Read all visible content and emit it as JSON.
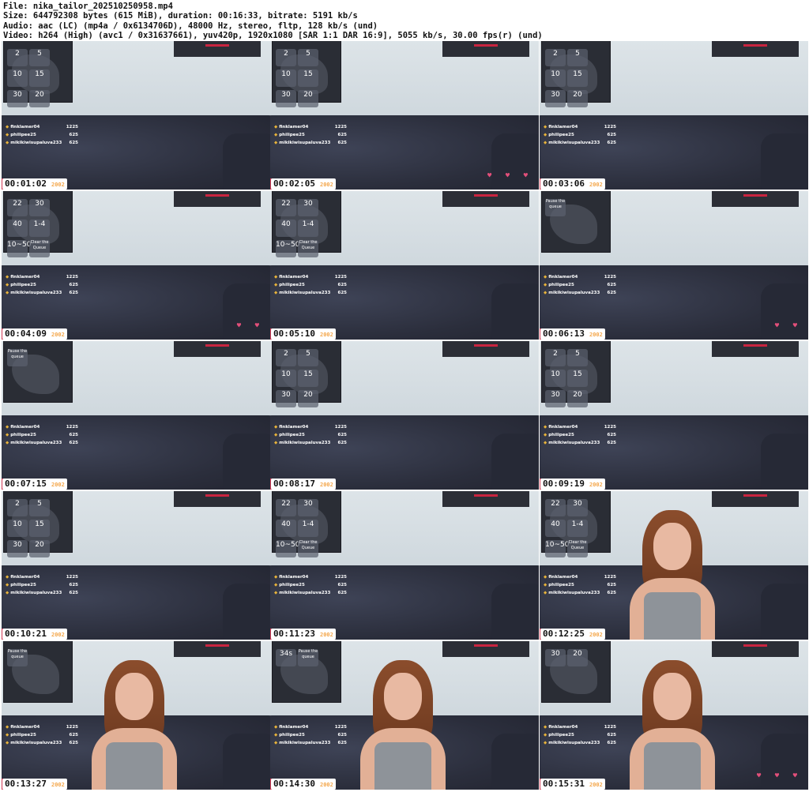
{
  "header": {
    "file": "File: nika_tailor_202510250958.mp4",
    "size": "Size: 644792308 bytes (615 MiB), duration: 00:16:33, bitrate: 5191 kb/s",
    "audio": "Audio: aac (LC) (mp4a / 0x6134706D), 48000 Hz, stereo, fltp, 128 kb/s (und)",
    "video": "Video: h264 (High) (avc1 / 0x31637661), yuv420p, 1920x1080 [SAR 1:1 DAR 16:9], 5055 kb/s, 30.00 fps(r) (und)"
  },
  "leaderboard": [
    {
      "name": "finklamer04",
      "value": "1225"
    },
    {
      "name": "philipee25",
      "value": "625"
    },
    {
      "name": "mikikiwisupaluva233",
      "value": "625"
    }
  ],
  "overlay_fade": "2002",
  "thumbnails": [
    {
      "time": "00:01:02",
      "tiles": [
        "2",
        "5",
        "10",
        "15",
        "30",
        "20"
      ],
      "person": false,
      "icons": ""
    },
    {
      "time": "00:02:05",
      "tiles": [
        "2",
        "5",
        "10",
        "15",
        "30",
        "20"
      ],
      "person": false,
      "icons": "♥ ♥ ♥"
    },
    {
      "time": "00:03:06",
      "tiles": [
        "2",
        "5",
        "10",
        "15",
        "30",
        "20"
      ],
      "person": false,
      "icons": ""
    },
    {
      "time": "00:04:09",
      "tiles": [
        "22",
        "30",
        "40",
        "1-4",
        "10~50",
        "Clear the Queue"
      ],
      "person": false,
      "icons": "♥ ♥"
    },
    {
      "time": "00:05:10",
      "tiles": [
        "22",
        "30",
        "40",
        "1-4",
        "10~50",
        "Clear the Queue"
      ],
      "person": false,
      "icons": ""
    },
    {
      "time": "00:06:13",
      "tiles": [
        "Pause the queue"
      ],
      "person": false,
      "icons": "♥ ♥"
    },
    {
      "time": "00:07:15",
      "tiles": [
        "Pause the queue"
      ],
      "person": false,
      "icons": ""
    },
    {
      "time": "00:08:17",
      "tiles": [
        "2",
        "5",
        "10",
        "15",
        "30",
        "20"
      ],
      "person": false,
      "icons": ""
    },
    {
      "time": "00:09:19",
      "tiles": [
        "2",
        "5",
        "10",
        "15",
        "30",
        "20"
      ],
      "person": false,
      "icons": ""
    },
    {
      "time": "00:10:21",
      "tiles": [
        "2",
        "5",
        "10",
        "15",
        "30",
        "20"
      ],
      "person": false,
      "icons": ""
    },
    {
      "time": "00:11:23",
      "tiles": [
        "22",
        "30",
        "40",
        "1-4",
        "10~50",
        "Clear the Queue"
      ],
      "person": false,
      "icons": ""
    },
    {
      "time": "00:12:25",
      "tiles": [
        "22",
        "30",
        "40",
        "1-4",
        "10~50",
        "Clear the Queue"
      ],
      "person": true,
      "icons": ""
    },
    {
      "time": "00:13:27",
      "tiles": [
        "Pause the queue"
      ],
      "person": true,
      "icons": ""
    },
    {
      "time": "00:14:30",
      "tiles": [
        "34s",
        "Pause the queue"
      ],
      "person": true,
      "icons": ""
    },
    {
      "time": "00:15:31",
      "tiles": [
        "30",
        "20"
      ],
      "person": true,
      "icons": "♥ ♥ ♥"
    }
  ]
}
